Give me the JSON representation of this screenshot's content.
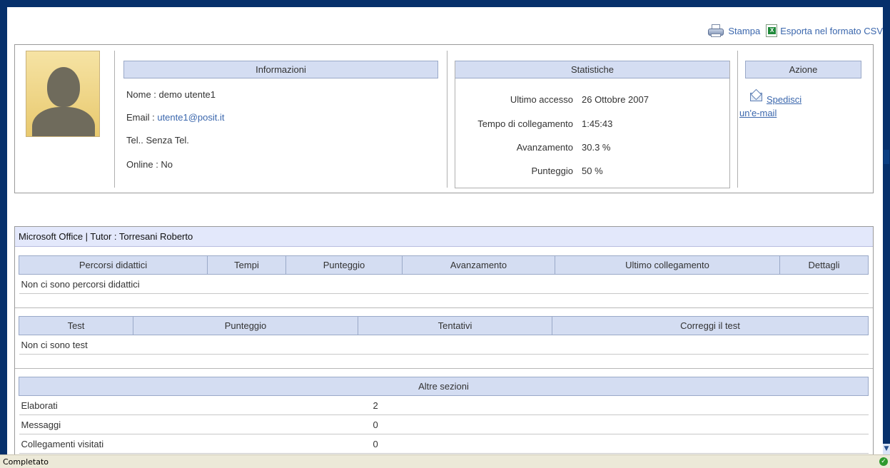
{
  "toolbar": {
    "print_label": "Stampa",
    "export_label": "Esporta nel formato CSV"
  },
  "profile": {
    "info_header": "Informazioni",
    "name_label": "Nome : ",
    "name_value": "demo utente1",
    "email_label": "Email : ",
    "email_value": "utente1@posit.it",
    "tel_text": "Tel.. Senza Tel.",
    "online_text": "Online : No"
  },
  "stats": {
    "header": "Statistiche",
    "rows": [
      {
        "label": "Ultimo accesso",
        "value": "26 Ottobre 2007"
      },
      {
        "label": "Tempo di collegamento",
        "value": "1:45:43"
      },
      {
        "label": "Avanzamento",
        "value": "30.3 %"
      },
      {
        "label": "Punteggio",
        "value": "50 %"
      }
    ]
  },
  "action": {
    "header": "Azione",
    "send_email_line1": "Spedisci",
    "send_email_line2": "un'e-mail"
  },
  "course": {
    "title": "Microsoft Office  |  Tutor : Torresani Roberto",
    "paths_table": {
      "columns": [
        "Percorsi didattici",
        "Tempi",
        "Punteggio",
        "Avanzamento",
        "Ultimo collegamento",
        "Dettagli"
      ],
      "empty_text": "Non ci sono percorsi didattici"
    },
    "tests_table": {
      "columns": [
        "Test",
        "Punteggio",
        "Tentativi",
        "Correggi il test"
      ],
      "empty_text": "Non ci sono test"
    },
    "other_table": {
      "header": "Altre sezioni",
      "rows": [
        {
          "label": "Elaborati",
          "value": "2"
        },
        {
          "label": "Messaggi",
          "value": "0"
        },
        {
          "label": "Collegamenti visitati",
          "value": "0"
        }
      ]
    }
  },
  "statusbar": {
    "text": "Completato"
  }
}
